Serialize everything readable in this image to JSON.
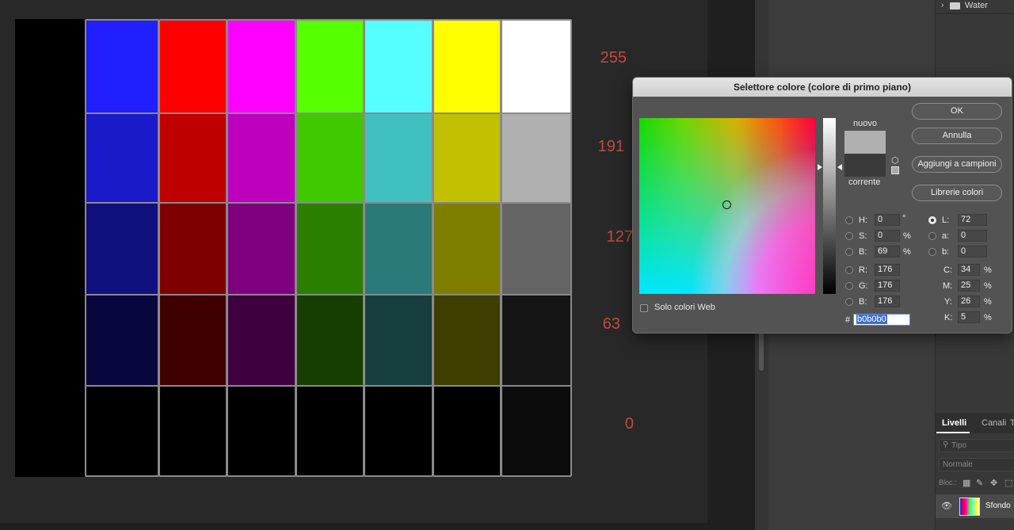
{
  "canvas": {
    "value_labels": [
      "255",
      "191",
      "127",
      "63",
      "0"
    ],
    "label_color": "#c04a42",
    "grid_colors": [
      [
        "#2020ff",
        "#ff0000",
        "#ff00ff",
        "#55ff00",
        "#55ffff",
        "#ffff00",
        "#ffffff"
      ],
      [
        "#1a1ac8",
        "#be0000",
        "#be00be",
        "#40c800",
        "#40c0c0",
        "#c0c000",
        "#b0b0b0"
      ],
      [
        "#10107e",
        "#7e0000",
        "#7e007e",
        "#2a7e00",
        "#2a7a7a",
        "#7e7e00",
        "#646464"
      ],
      [
        "#07073e",
        "#3e0000",
        "#3e003e",
        "#163e00",
        "#163e3e",
        "#3e3e00",
        "#141414"
      ],
      [
        "#000000",
        "#000000",
        "#000000",
        "#000000",
        "#000000",
        "#000000",
        "#0c0c0c"
      ]
    ]
  },
  "dialog": {
    "title": "Selettore colore (colore di primo piano)",
    "new_label": "nuovo",
    "current_label": "corrente",
    "new_color": "#b0b0b0",
    "current_color": "#3a3a3a",
    "buttons": {
      "ok": "OK",
      "cancel": "Annulla",
      "add_swatch": "Aggiungi a campioni",
      "libraries": "Librerie colori"
    },
    "web_only_label": "Solo colori Web",
    "hsb": [
      {
        "label": "H:",
        "value": "0",
        "unit": "°"
      },
      {
        "label": "S:",
        "value": "0",
        "unit": "%"
      },
      {
        "label": "B:",
        "value": "69",
        "unit": "%"
      }
    ],
    "rgb": [
      {
        "label": "R:",
        "value": "176"
      },
      {
        "label": "G:",
        "value": "176"
      },
      {
        "label": "B:",
        "value": "176"
      }
    ],
    "lab": [
      {
        "label": "L:",
        "value": "72"
      },
      {
        "label": "a:",
        "value": "0"
      },
      {
        "label": "b:",
        "value": "0"
      }
    ],
    "cmyk": [
      {
        "label": "C:",
        "value": "34",
        "unit": "%"
      },
      {
        "label": "M:",
        "value": "25",
        "unit": "%"
      },
      {
        "label": "Y:",
        "value": "26",
        "unit": "%"
      },
      {
        "label": "K:",
        "value": "5",
        "unit": "%"
      }
    ],
    "hex_prefix": "#",
    "hex_value": "b0b0b0"
  },
  "right_panel": {
    "folder_name": "Water",
    "tabs": [
      "Livelli",
      "Canali",
      "T"
    ],
    "kind_filter": "Tipo",
    "blend_mode": "Normale",
    "lock_label": "Bloc.:",
    "layer_name": "Sfondo"
  }
}
